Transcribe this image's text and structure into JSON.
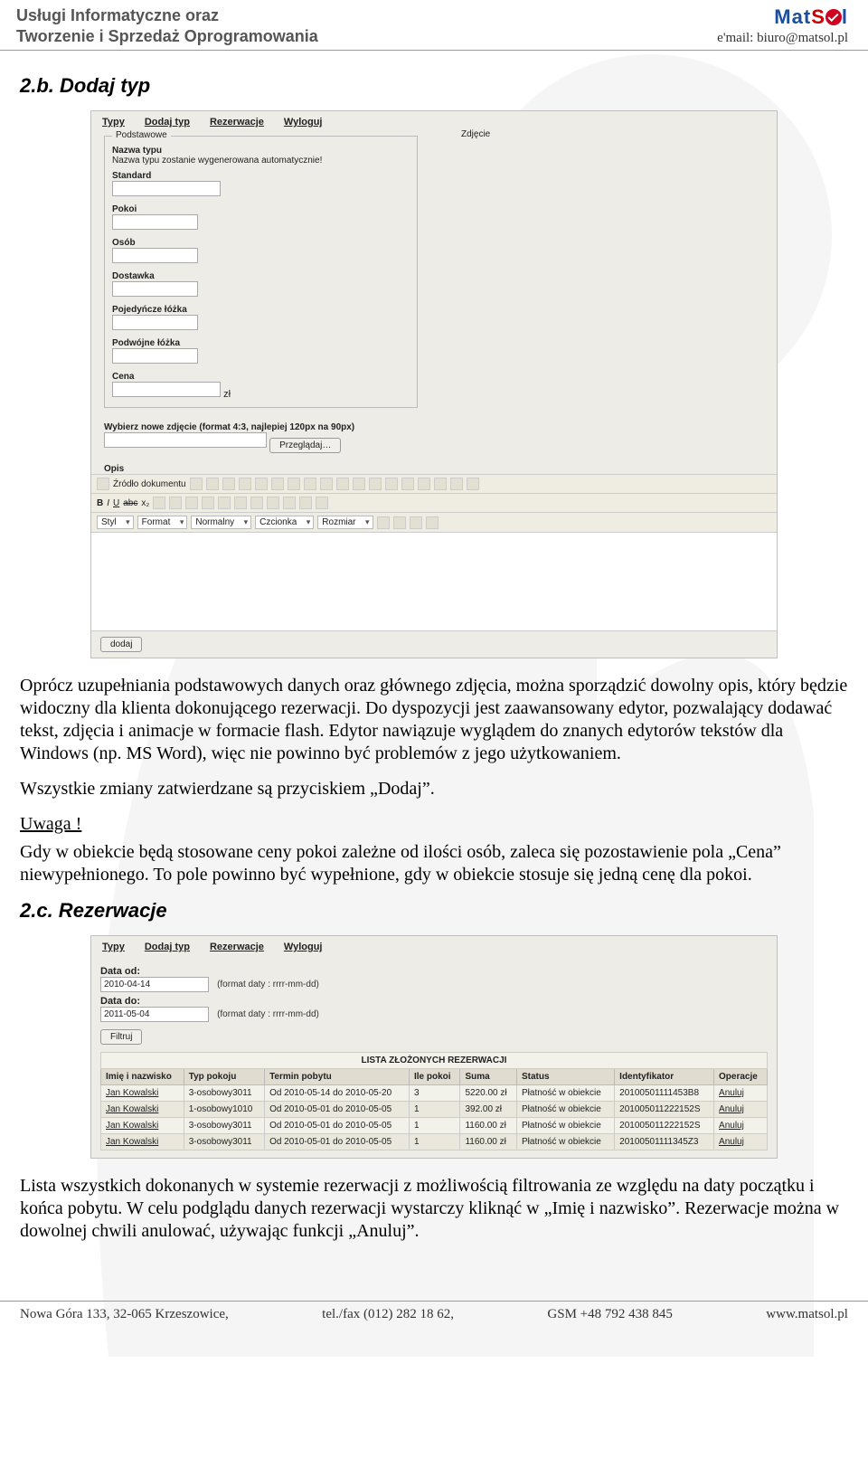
{
  "header": {
    "line1": "Usługi Informatyczne oraz",
    "line2": "Tworzenie i Sprzedaż Oprogramowania",
    "email_line": "e'mail: biuro@matsol.pl",
    "logo_mat": "Mat",
    "logo_s": "S",
    "logo_l": "l"
  },
  "section_2b_title": "2.b. Dodaj typ",
  "form1": {
    "nav": {
      "typy": "Typy",
      "dodaj": "Dodaj typ",
      "rez": "Rezerwacje",
      "wyloguj": "Wyloguj"
    },
    "fs_podst_legend": "Podstawowe",
    "fs_zdjecie_legend": "Zdjęcie",
    "nazwa_label": "Nazwa typu",
    "nazwa_note": "Nazwa typu zostanie wygenerowana automatycznie!",
    "standard_label": "Standard",
    "pokoi_label": "Pokoi",
    "osob_label": "Osób",
    "dostawka_label": "Dostawka",
    "poj_lozka_label": "Pojedyńcze łóżka",
    "podw_lozka_label": "Podwójne łóżka",
    "cena_label": "Cena",
    "cena_unit": "zł",
    "wybierz_label": "Wybierz nowe zdjęcie (format 4:3, najlepiej 120px na 90px)",
    "przegladaj_btn": "Przeglądaj…",
    "opis_label": "Opis",
    "tb_source": "Źródło dokumentu",
    "tb_b": "B",
    "tb_i": "I",
    "tb_u": "U",
    "tb_abc": "abc",
    "tb_x2": "x₂",
    "tb_styl": "Styl",
    "tb_format": "Format",
    "tb_normalny": "Normalny",
    "tb_czcionka": "Czcionka",
    "tb_rozmiar": "Rozmiar",
    "dodaj_btn": "dodaj"
  },
  "para1": "Oprócz uzupełniania podstawowych danych oraz głównego zdjęcia, można sporządzić dowolny opis, który będzie widoczny dla klienta dokonującego rezerwacji. Do dyspozycji jest zaawansowany edytor, pozwalający dodawać tekst, zdjęcia i animacje w formacie flash. Edytor nawiązuje wyglądem do znanych edytorów tekstów dla Windows (np. MS Word), więc nie powinno być problemów z jego użytkowaniem.",
  "para2": "Wszystkie zmiany zatwierdzane są przyciskiem „Dodaj”.",
  "uwaga": "Uwaga !",
  "para3": "Gdy w obiekcie będą stosowane ceny pokoi zależne od ilości osób, zaleca się pozostawienie pola „Cena” niewypełnionego. To pole powinno być wypełnione, gdy w obiekcie stosuje się jedną cenę dla pokoi.",
  "section_2c_title": "2.c. Rezerwacje",
  "form2": {
    "nav": {
      "typy": "Typy",
      "dodaj": "Dodaj typ",
      "rez": "Rezerwacje",
      "wyloguj": "Wyloguj"
    },
    "data_od_label": "Data od:",
    "data_od_val": "2010-04-14",
    "data_do_label": "Data do:",
    "data_do_val": "2011-05-04",
    "format_note": "(format daty : rrrr-mm-dd)",
    "filtruj_btn": "Filtruj",
    "table_title": "LISTA ZŁOŻONYCH REZERWACJI",
    "cols": {
      "imie": "Imię i nazwisko",
      "typ": "Typ pokoju",
      "termin": "Termin pobytu",
      "ile": "Ile pokoi",
      "suma": "Suma",
      "status": "Status",
      "ident": "Identyfikator",
      "oper": "Operacje"
    },
    "rows": [
      {
        "imie": "Jan Kowalski",
        "typ": "3-osobowy3011",
        "termin": "Od 2010-05-14 do 2010-05-20",
        "ile": "3",
        "suma": "5220.00 zł",
        "status": "Płatność w obiekcie",
        "ident": "20100501111453B8",
        "oper": "Anuluj"
      },
      {
        "imie": "Jan Kowalski",
        "typ": "1-osobowy1010",
        "termin": "Od 2010-05-01 do 2010-05-05",
        "ile": "1",
        "suma": "392.00 zł",
        "status": "Płatność w obiekcie",
        "ident": "201005011222152S",
        "oper": "Anuluj"
      },
      {
        "imie": "Jan Kowalski",
        "typ": "3-osobowy3011",
        "termin": "Od 2010-05-01 do 2010-05-05",
        "ile": "1",
        "suma": "1160.00 zł",
        "status": "Płatność w obiekcie",
        "ident": "201005011222152S",
        "oper": "Anuluj"
      },
      {
        "imie": "Jan Kowalski",
        "typ": "3-osobowy3011",
        "termin": "Od 2010-05-01 do 2010-05-05",
        "ile": "1",
        "suma": "1160.00 zł",
        "status": "Płatność w obiekcie",
        "ident": "20100501111345Z3",
        "oper": "Anuluj"
      }
    ]
  },
  "para4": "Lista wszystkich dokonanych w systemie rezerwacji z możliwością filtrowania ze względu na daty początku i końca pobytu. W celu podglądu danych rezerwacji wystarczy kliknąć w „Imię i nazwisko”. Rezerwacje można w dowolnej chwili anulować, używając funkcji „Anuluj”.",
  "footer": {
    "addr": "Nowa Góra 133, 32-065 Krzeszowice,",
    "tel": "tel./fax (012) 282 18 62,",
    "gsm": "GSM +48 792 438 845",
    "www": "www.matsol.pl"
  }
}
